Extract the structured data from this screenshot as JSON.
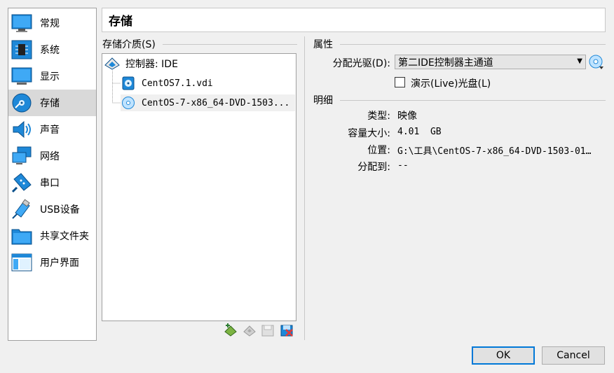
{
  "sidebar": {
    "items": [
      {
        "label": "常规",
        "icon": "general-icon"
      },
      {
        "label": "系统",
        "icon": "system-icon"
      },
      {
        "label": "显示",
        "icon": "display-icon"
      },
      {
        "label": "存储",
        "icon": "storage-icon"
      },
      {
        "label": "声音",
        "icon": "audio-icon"
      },
      {
        "label": "网络",
        "icon": "network-icon"
      },
      {
        "label": "串口",
        "icon": "serial-port-icon"
      },
      {
        "label": "USB设备",
        "icon": "usb-icon"
      },
      {
        "label": "共享文件夹",
        "icon": "shared-folder-icon"
      },
      {
        "label": "用户界面",
        "icon": "user-interface-icon"
      }
    ],
    "selected": "存储"
  },
  "page": {
    "title": "存储"
  },
  "storage": {
    "section_label": "存储介质(S)",
    "controller": "控制器: IDE",
    "devices": [
      {
        "name": "CentOS7.1.vdi",
        "icon": "hard-disk-icon"
      },
      {
        "name": "CentOS-7-x86_64-DVD-1503...",
        "icon": "optical-disc-icon"
      }
    ],
    "toolbar": {
      "add_controller": "add-controller-icon",
      "add_attachment": "add-attachment-icon",
      "remove_attachment": "remove-attachment-icon",
      "remove_controller": "remove-controller-icon"
    }
  },
  "attributes": {
    "section_label": "属性",
    "drive_label": "分配光驱(D):",
    "drive_value": "第二IDE控制器主通道",
    "live_cd_label": "演示(Live)光盘(L)",
    "live_cd_checked": false
  },
  "details": {
    "section_label": "明细",
    "type_label": "类型:",
    "type_value": "映像",
    "size_label": "容量大小:",
    "size_value": "4.01  GB",
    "location_label": "位置:",
    "location_value": "G:\\工具\\CentOS-7-x86_64-DVD-1503-01…",
    "attached_label": "分配到:",
    "attached_value": "--"
  },
  "buttons": {
    "ok": "OK",
    "cancel": "Cancel"
  },
  "colors": {
    "accent": "#0078d7",
    "selection": "#d9d9d9",
    "icon_blue": "#1e88d8"
  }
}
